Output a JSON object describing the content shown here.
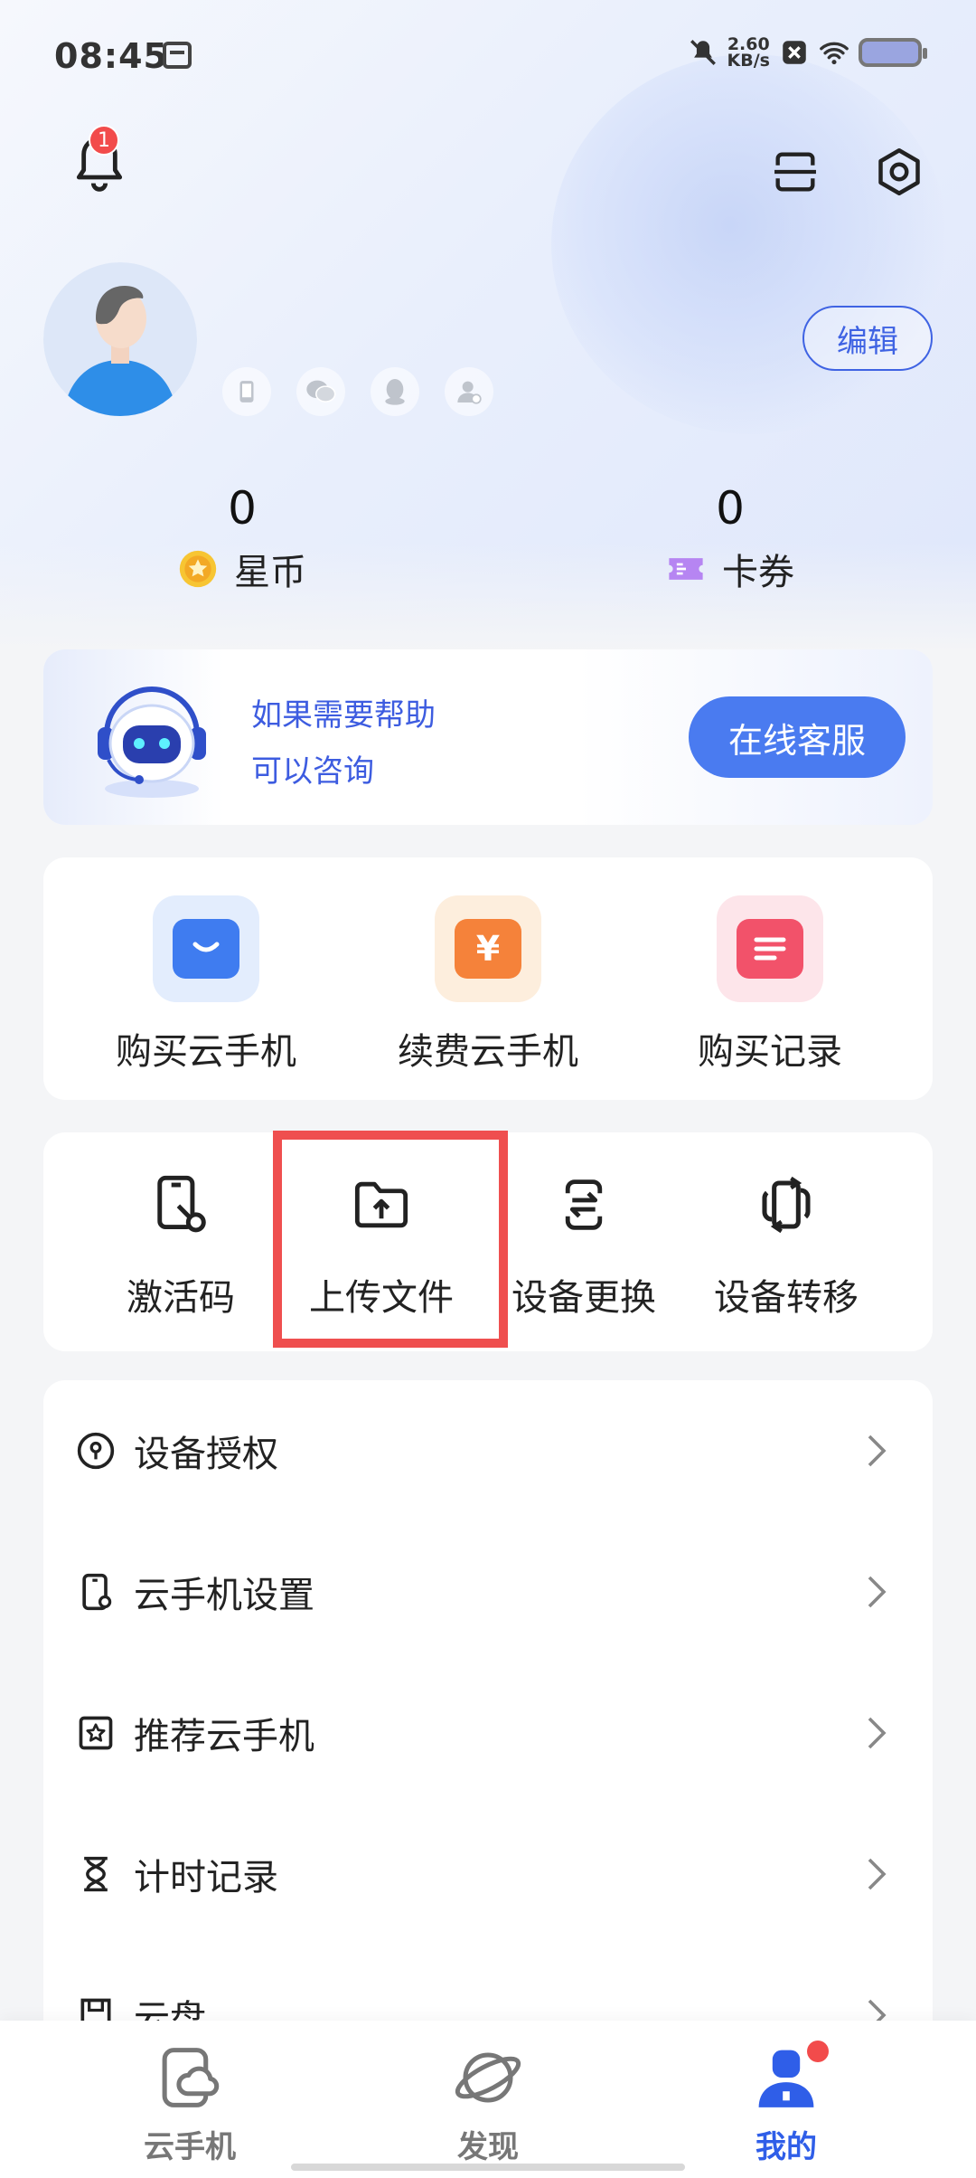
{
  "status_bar": {
    "time": "08:45",
    "net_speed_value": "2.60",
    "net_speed_unit": "KB/s",
    "icons": [
      "app-notification-icon",
      "mute-icon",
      "close-box-icon",
      "wifi-icon",
      "battery-icon"
    ]
  },
  "header": {
    "notification_badge": "1",
    "icons": [
      "bell-icon",
      "scan-icon",
      "settings-icon"
    ]
  },
  "profile": {
    "edit_label": "编辑",
    "bind_icons": [
      "phone-icon",
      "wechat-icon",
      "qq-icon",
      "user-verify-icon"
    ]
  },
  "stats": {
    "coins": {
      "value": "0",
      "label": "星币"
    },
    "coupons": {
      "value": "0",
      "label": "卡券"
    }
  },
  "support": {
    "line1": "如果需要帮助",
    "line2": "可以咨询",
    "button_label": "在线客服"
  },
  "purchase": {
    "items": [
      {
        "label": "购买云手机",
        "icon": "bag-icon",
        "color": "#3f7cf0"
      },
      {
        "label": "续费云手机",
        "icon": "yuan-icon",
        "color": "#f5823a"
      },
      {
        "label": "购买记录",
        "icon": "list-icon",
        "color": "#f2526a"
      }
    ]
  },
  "tools": {
    "items": [
      {
        "label": "激活码",
        "icon": "activation-phone-icon"
      },
      {
        "label": "上传文件",
        "icon": "upload-folder-icon"
      },
      {
        "label": "设备更换",
        "icon": "swap-icon"
      },
      {
        "label": "设备转移",
        "icon": "transfer-icon"
      }
    ],
    "highlight_color": "#ef4f4f"
  },
  "menu": {
    "items": [
      {
        "label": "设备授权",
        "icon": "authorize-icon"
      },
      {
        "label": "云手机设置",
        "icon": "phone-settings-icon"
      },
      {
        "label": "推荐云手机",
        "icon": "recommend-icon"
      },
      {
        "label": "计时记录",
        "icon": "hourglass-icon"
      },
      {
        "label": "云盘",
        "icon": "cloud-disk-icon"
      }
    ]
  },
  "bottom_nav": {
    "items": [
      {
        "label": "云手机",
        "icon": "cloud-phone-icon",
        "active": false
      },
      {
        "label": "发现",
        "icon": "planet-icon",
        "active": false
      },
      {
        "label": "我的",
        "icon": "profile-icon",
        "active": true
      }
    ],
    "active_color": "#2f5ee8"
  }
}
